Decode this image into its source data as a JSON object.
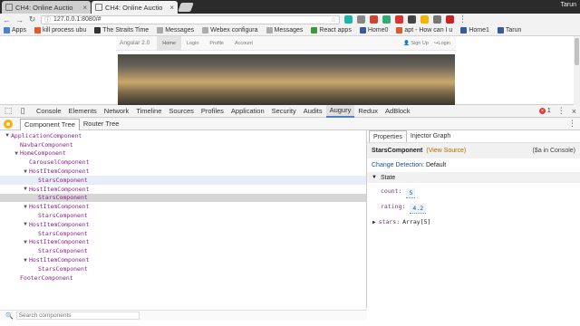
{
  "browser": {
    "tabs": [
      {
        "title": "CH4: Online Auctio",
        "close": "×"
      },
      {
        "title": "CH4: Online Auctio",
        "close": "×"
      }
    ],
    "profile": "Tarun",
    "url": "127.0.0.1:8080/#",
    "bookmarks": [
      {
        "label": "Apps",
        "color": "#4a7fd4"
      },
      {
        "label": "kill process ubu",
        "color": "#e05a2b"
      },
      {
        "label": "The Straits Time",
        "color": "#333333"
      },
      {
        "label": "Messages",
        "color": "#aaaaaa"
      },
      {
        "label": "Webex configura",
        "color": "#aaaaaa"
      },
      {
        "label": "Messages",
        "color": "#aaaaaa"
      },
      {
        "label": "React apps",
        "color": "#3c9a3c"
      },
      {
        "label": "Home0",
        "color": "#3b5998"
      },
      {
        "label": "apt - How can I u",
        "color": "#e05a2b"
      },
      {
        "label": "Home1",
        "color": "#3b5998"
      },
      {
        "label": "Tarun",
        "color": "#3b5998"
      }
    ]
  },
  "app": {
    "brand": "Angular 2.0",
    "links": [
      "Home",
      "Login",
      "Profile",
      "Account"
    ],
    "signup": "Sign Up",
    "login": "Login"
  },
  "devtools": {
    "tabs": [
      "Console",
      "Elements",
      "Network",
      "Timeline",
      "Sources",
      "Profiles",
      "Application",
      "Security",
      "Audits",
      "Augury",
      "Redux",
      "AdBlock"
    ],
    "active_tab": "Augury",
    "error_count": "1"
  },
  "augury": {
    "tabs": [
      "Component Tree",
      "Router Tree"
    ],
    "tree": [
      {
        "label": "ApplicationComponent",
        "depth": 0,
        "arrow": "▼"
      },
      {
        "label": "NavbarComponent",
        "depth": 1,
        "arrow": ""
      },
      {
        "label": "HomeComponent",
        "depth": 1,
        "arrow": "▼"
      },
      {
        "label": "CarouselComponent",
        "depth": 2,
        "arrow": ""
      },
      {
        "label": "HostItemComponent",
        "depth": 2,
        "arrow": "▼"
      },
      {
        "label": "StarsComponent",
        "depth": 3,
        "arrow": ""
      },
      {
        "label": "HostItemComponent",
        "depth": 2,
        "arrow": "▼"
      },
      {
        "label": "StarsComponent",
        "depth": 3,
        "arrow": ""
      },
      {
        "label": "HostItemComponent",
        "depth": 2,
        "arrow": "▼"
      },
      {
        "label": "StarsComponent",
        "depth": 3,
        "arrow": ""
      },
      {
        "label": "HostItemComponent",
        "depth": 2,
        "arrow": "▼"
      },
      {
        "label": "StarsComponent",
        "depth": 3,
        "arrow": ""
      },
      {
        "label": "HostItemComponent",
        "depth": 2,
        "arrow": "▼"
      },
      {
        "label": "StarsComponent",
        "depth": 3,
        "arrow": ""
      },
      {
        "label": "HostItemComponent",
        "depth": 2,
        "arrow": "▼"
      },
      {
        "label": "StarsComponent",
        "depth": 3,
        "arrow": ""
      },
      {
        "label": "FooterComponent",
        "depth": 1,
        "arrow": ""
      }
    ],
    "hover_index": 5,
    "selected_index": 7,
    "search_placeholder": "Search components",
    "props_tabs": [
      "Properties",
      "Injector Graph"
    ],
    "component_name": "StarsComponent",
    "view_source": "(View Source)",
    "console_hint": "($a in Console)",
    "change_detection_label": "Change Detection:",
    "change_detection_value": "Default",
    "state_label": "State",
    "state": {
      "count_key": "count:",
      "count_val": "5",
      "rating_key": "rating:",
      "rating_val": "4.2",
      "stars_key": "stars:",
      "stars_val": "Array[5]"
    }
  }
}
